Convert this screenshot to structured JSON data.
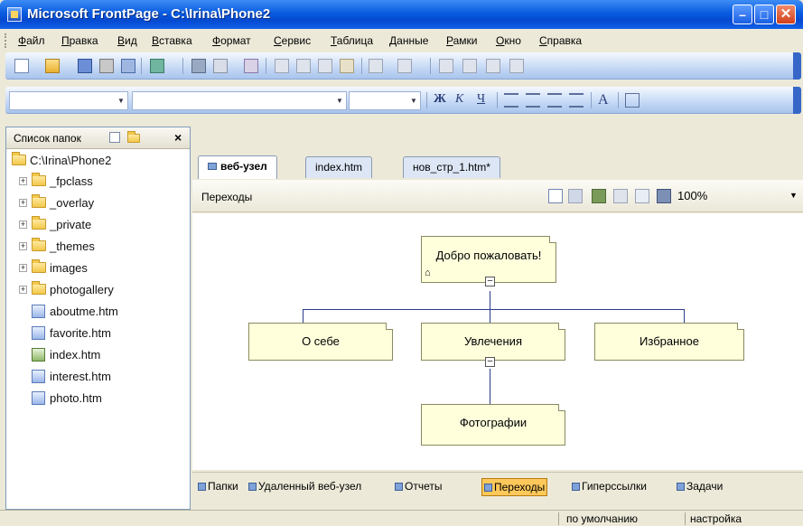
{
  "window": {
    "title": "Microsoft FrontPage - C:\\Irina\\Phone2"
  },
  "menu": [
    "Файл",
    "Правка",
    "Вид",
    "Вставка",
    "Формат",
    "Сервис",
    "Таблица",
    "Данные",
    "Рамки",
    "Окно",
    "Справка"
  ],
  "format_buttons": [
    "Ж",
    "К",
    "Ч",
    "A"
  ],
  "folder_pane": {
    "title": "Список папок",
    "root": "C:\\Irina\\Phone2",
    "folders": [
      "_fpclass",
      "_overlay",
      "_private",
      "_themes",
      "images",
      "photogallery"
    ],
    "files": [
      "aboutme.htm",
      "favorite.htm",
      "index.htm",
      "interest.htm",
      "photo.htm"
    ]
  },
  "tabs": [
    "веб-узел",
    "index.htm",
    "нов_стр_1.htm*"
  ],
  "view": {
    "title": "Переходы",
    "zoom": "100%"
  },
  "nav_tree": {
    "root": "Добро пожаловать!",
    "children": [
      "О себе",
      "Увлечения",
      "Избранное"
    ],
    "grandchild": "Фотографии"
  },
  "view_tabs": [
    "Папки",
    "Удаленный веб-узел",
    "Отчеты",
    "Переходы",
    "Гиперссылки",
    "Задачи"
  ],
  "status": [
    "по умолчанию",
    "настройка"
  ]
}
